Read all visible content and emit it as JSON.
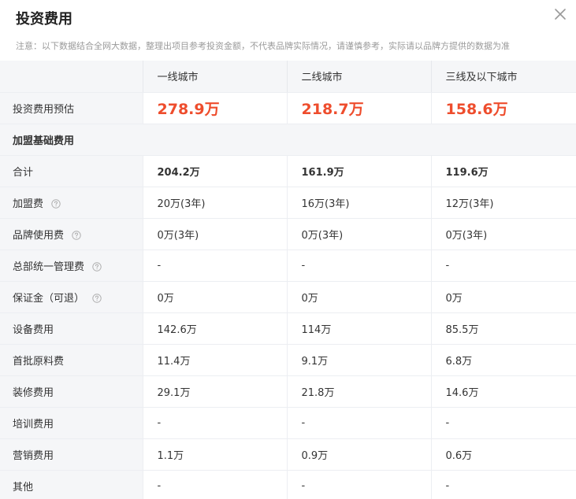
{
  "dialog": {
    "title": "投资费用",
    "notice": "注意：以下数据结合全网大数据，整理出项目参考投资金额，不代表品牌实际情况，请谨慎参考，实际请以品牌方提供的数据为准"
  },
  "columns": [
    "一线城市",
    "二线城市",
    "三线及以下城市"
  ],
  "estimate": {
    "label": "投资费用预估",
    "values": [
      "278.9万",
      "218.7万",
      "158.6万"
    ]
  },
  "section_label": "加盟基础费用",
  "total": {
    "label": "合计",
    "values": [
      "204.2万",
      "161.9万",
      "119.6万"
    ]
  },
  "rows": [
    {
      "label": "加盟费",
      "help": true,
      "values": [
        "20万(3年)",
        "16万(3年)",
        "12万(3年)"
      ]
    },
    {
      "label": "品牌使用费",
      "help": true,
      "values": [
        "0万(3年)",
        "0万(3年)",
        "0万(3年)"
      ]
    },
    {
      "label": "总部统一管理费",
      "help": true,
      "values": [
        "-",
        "-",
        "-"
      ]
    },
    {
      "label": "保证金（可退）",
      "help": true,
      "values": [
        "0万",
        "0万",
        "0万"
      ]
    },
    {
      "label": "设备费用",
      "help": false,
      "values": [
        "142.6万",
        "114万",
        "85.5万"
      ]
    },
    {
      "label": "首批原料费",
      "help": false,
      "values": [
        "11.4万",
        "9.1万",
        "6.8万"
      ]
    },
    {
      "label": "装修费用",
      "help": false,
      "values": [
        "29.1万",
        "21.8万",
        "14.6万"
      ]
    },
    {
      "label": "培训费用",
      "help": false,
      "values": [
        "-",
        "-",
        "-"
      ]
    },
    {
      "label": "营销费用",
      "help": false,
      "values": [
        "1.1万",
        "0.9万",
        "0.6万"
      ]
    },
    {
      "label": "其他",
      "help": false,
      "values": [
        "-",
        "-",
        "-"
      ]
    }
  ],
  "colors": {
    "accent": "#ee4d2d",
    "label_bg": "#f5f6f8",
    "muted": "#9a9a9a"
  },
  "icons": {
    "close": "close-icon",
    "help": "question-circle-icon"
  }
}
